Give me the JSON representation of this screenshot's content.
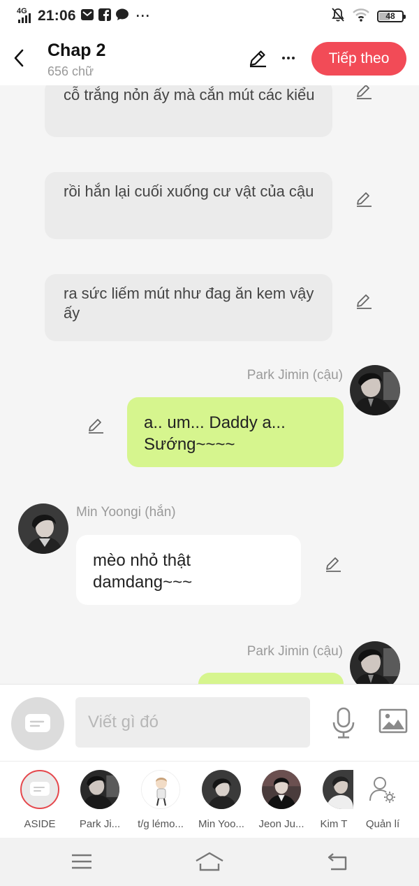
{
  "status_bar": {
    "network": "4G",
    "time": "21:06",
    "battery": "48",
    "battery_level": 0.48
  },
  "header": {
    "title": "Chap 2",
    "word_count": "656 chữ",
    "next_label": "Tiếp theo"
  },
  "messages": [
    {
      "type": "narration",
      "text": "cỗ trắng nỏn ấy mà cắn mút các kiểu"
    },
    {
      "type": "narration",
      "text": "rồi hắn lại cuối xuống cư vật của cậu"
    },
    {
      "type": "narration",
      "text": "ra sức liếm mút như đag ăn kem vậy ấy"
    },
    {
      "type": "right",
      "speaker": "Park Jimin (cậu)",
      "text": "a.. um... Daddy a... Sướng~~~~"
    },
    {
      "type": "left",
      "speaker": "Min Yoongi (hắn)",
      "text": "mèo nhỏ thật damdang~~~"
    },
    {
      "type": "right",
      "speaker": "Park Jimin (cậu)",
      "text": ""
    }
  ],
  "composer": {
    "placeholder": "Viết gì đó"
  },
  "characters": [
    {
      "name": "ASIDE"
    },
    {
      "name": "Park Ji..."
    },
    {
      "name": "t/g lémo..."
    },
    {
      "name": "Min Yoo..."
    },
    {
      "name": "Jeon Ju..."
    },
    {
      "name": "Kim T"
    },
    {
      "name": "Quản lí"
    }
  ],
  "colors": {
    "accent": "#f24b57",
    "self_bubble": "#d6f58e",
    "narration_bubble": "#ebebeb"
  },
  "icons": {
    "back": "chevron-left-icon",
    "edit": "pencil-icon",
    "more": "more-dots-icon",
    "aside": "chat-bubble-icon",
    "mic": "microphone-icon",
    "image": "image-icon",
    "manage": "user-gear-icon",
    "nav_menu": "menu-icon",
    "nav_home": "home-icon",
    "nav_back": "return-icon"
  }
}
